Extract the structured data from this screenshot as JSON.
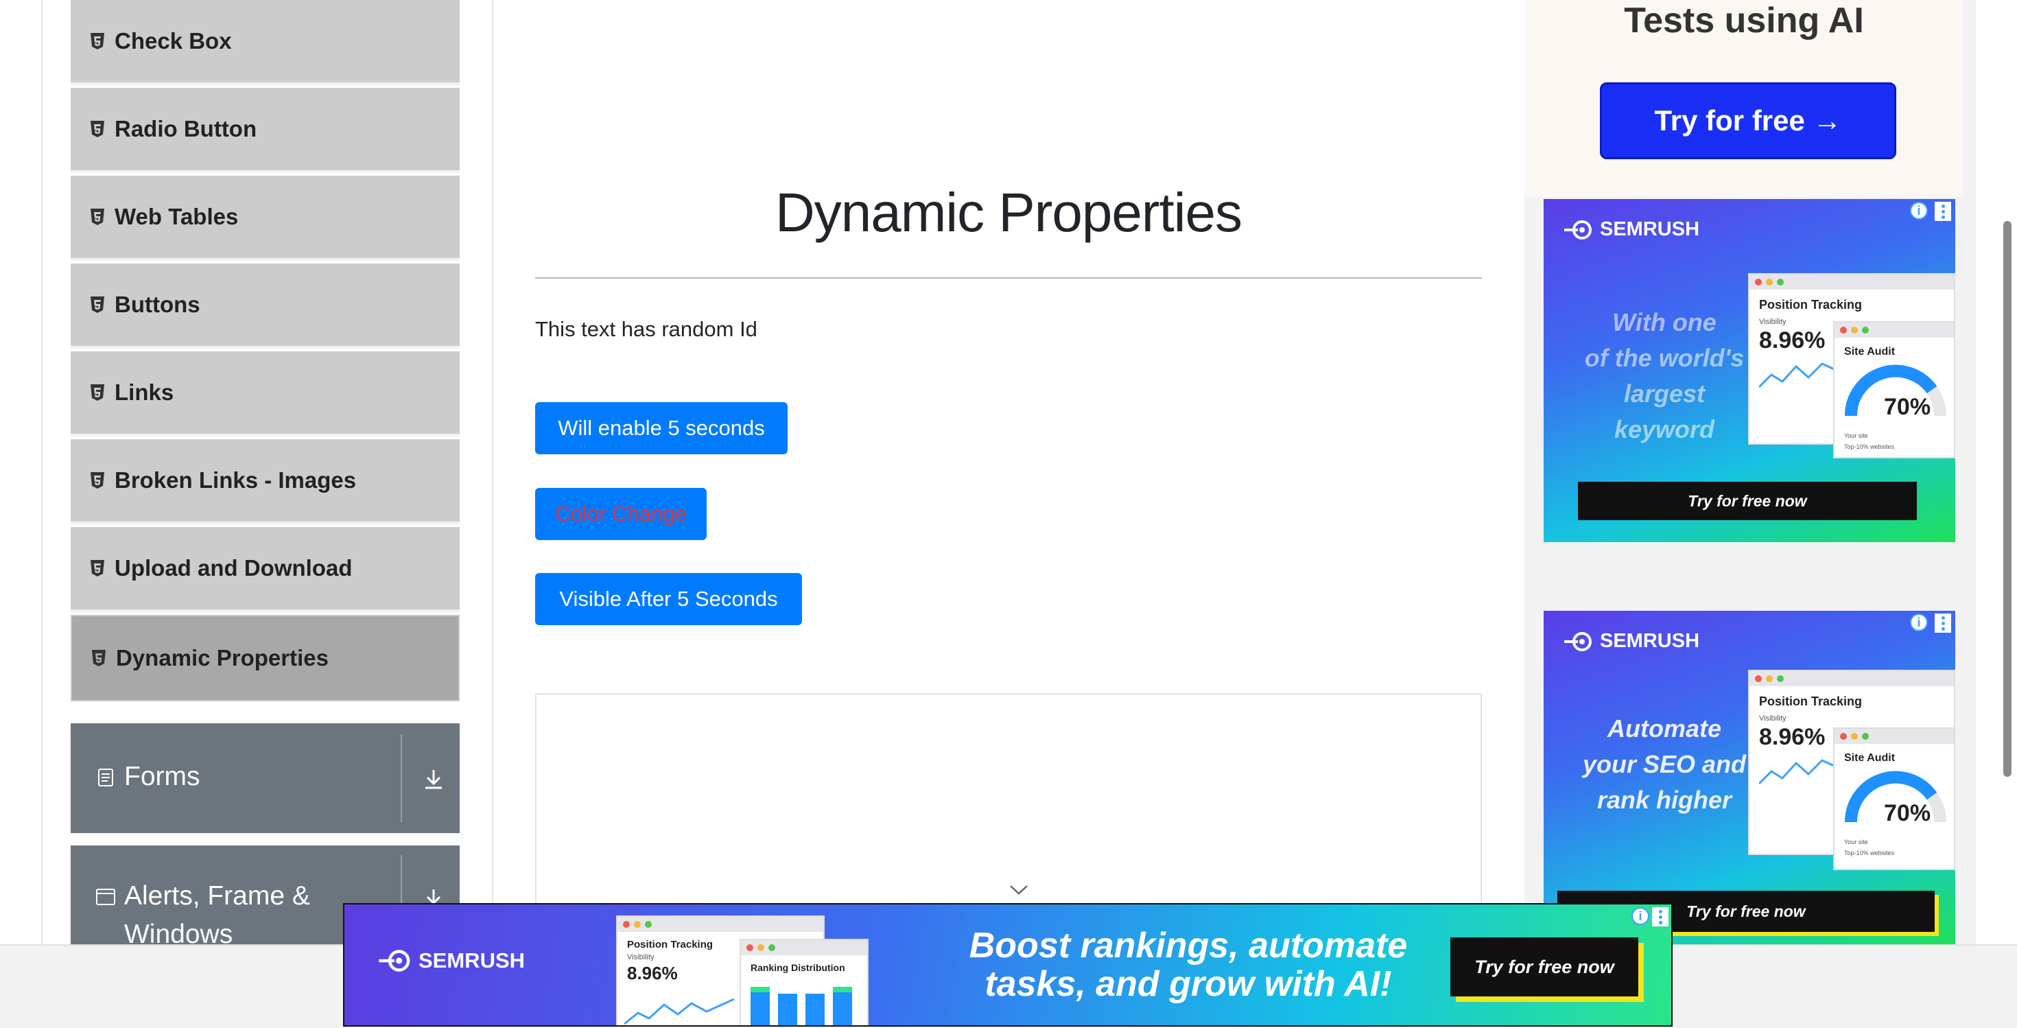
{
  "sidebar": {
    "elements_items": [
      {
        "label": "Check Box",
        "active": false
      },
      {
        "label": "Radio Button",
        "active": false
      },
      {
        "label": "Web Tables",
        "active": false
      },
      {
        "label": "Buttons",
        "active": false
      },
      {
        "label": "Links",
        "active": false
      },
      {
        "label": "Broken Links - Images",
        "active": false
      },
      {
        "label": "Upload and Download",
        "active": false
      },
      {
        "label": "Dynamic Properties",
        "active": true
      }
    ],
    "groups": {
      "forms": {
        "label": "Forms",
        "icon": "document-icon",
        "toggle_icon": "download-arrow-icon"
      },
      "alerts": {
        "label_line1": "Alerts, Frame &",
        "label_line2": "Windows",
        "icon": "window-icon",
        "toggle_icon": "download-arrow-icon"
      }
    },
    "item_icon": "html5-icon"
  },
  "main": {
    "title": "Dynamic Properties",
    "random_id_text": "This text has random Id",
    "buttons": {
      "enable_after": "Will enable 5 seconds",
      "color_change": "Color Change",
      "visible_after": "Visible After 5 Seconds"
    },
    "accent_color": "#007bff",
    "color_change_text_color": "#dc3545"
  },
  "ads": {
    "top_ad": {
      "title": "Tests using AI",
      "button": "Try for free →"
    },
    "square_ad_1": {
      "brand": "SEMRUSH",
      "tagline": [
        "With one",
        "of the world's",
        "largest",
        "keyword"
      ],
      "window1_title": "Position Tracking",
      "window1_sub": "Visibility",
      "window1_value": "8.96%",
      "window2_title": "Site Audit",
      "window2_value": "70%",
      "legend1": "Your site",
      "legend2": "Top-10% websites",
      "cta": "Try for free now",
      "info": "i"
    },
    "square_ad_2": {
      "brand": "SEMRUSH",
      "tagline": [
        "Automate",
        "your SEO and",
        "rank higher"
      ],
      "window1_title": "Position Tracking",
      "window1_sub": "Visibility",
      "window1_value": "8.96%",
      "window2_title": "Site Audit",
      "window2_value": "70%",
      "legend1": "Your site",
      "legend2": "Top-10% websites",
      "cta": "Try for free now",
      "info": "i"
    },
    "banner": {
      "brand": "SEMRUSH",
      "window1_title": "Position Tracking",
      "window1_sub": "Visibility",
      "window1_value": "8.96%",
      "window2_title": "Ranking Distribution",
      "headline_line1": "Boost rankings, automate",
      "headline_line2": "tasks, and grow with AI!",
      "cta": "Try for free now",
      "info": "i"
    }
  }
}
